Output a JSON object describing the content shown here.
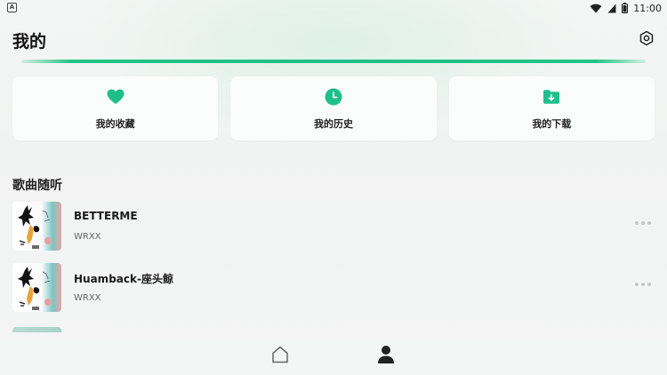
{
  "status_bar": {
    "app_indicator": "A",
    "time": "11:00"
  },
  "header": {
    "title": "我的"
  },
  "quick_actions": [
    {
      "label": "我的收藏",
      "icon": "heart-icon"
    },
    {
      "label": "我的历史",
      "icon": "clock-icon"
    },
    {
      "label": "我的下载",
      "icon": "download-folder-icon"
    }
  ],
  "section": {
    "title": "歌曲随听"
  },
  "songs": [
    {
      "name": "BETTERME",
      "artist": "WRXX"
    },
    {
      "name": "Huamback-座头鲸",
      "artist": "WRXX"
    }
  ],
  "colors": {
    "accent": "#1fbf8a",
    "background": "#f2f4f3",
    "card": "#fbfcfc"
  },
  "bottom_nav": [
    {
      "name": "home",
      "icon": "home-icon",
      "active": false
    },
    {
      "name": "me",
      "icon": "person-icon",
      "active": true
    }
  ]
}
